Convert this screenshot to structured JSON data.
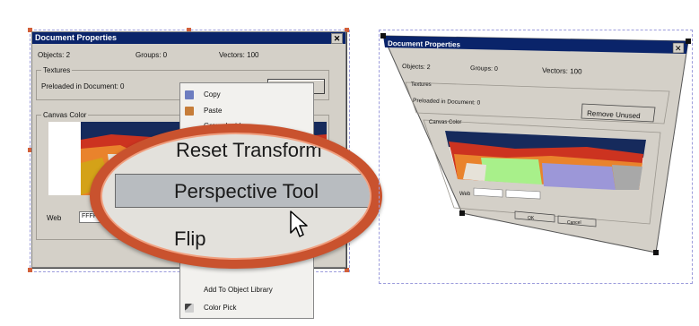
{
  "dialog": {
    "title": "Document Properties",
    "close_glyph": "✕",
    "objects_label": "Objects: 2",
    "groups_label": "Groups: 0",
    "vectors_label": "Vectors: 100",
    "textures_heading": "Textures",
    "preloaded_label": "Preloaded in Document: 0",
    "remove_unused_button": "Remove Unused",
    "canvas_color_heading": "Canvas Color",
    "web_label": "Web",
    "web_value": "FFFF",
    "ok_button": "OK",
    "cancel_button": "Cancel"
  },
  "context_menu": {
    "items": [
      {
        "label": "Copy",
        "icon": "copy-icon"
      },
      {
        "label": "Paste",
        "icon": "paste-icon"
      },
      {
        "label": "Group Inside",
        "icon": ""
      },
      {
        "label": "Add To Object Library",
        "icon": ""
      },
      {
        "label": "Color Pick",
        "icon": "eyedropper-icon"
      }
    ]
  },
  "magnifier": {
    "items": [
      "Reset Transform",
      "Perspective Tool",
      "Flip"
    ],
    "highlighted": "Perspective Tool",
    "cursor": "arrow-cursor-icon"
  },
  "colors": {
    "title_bar": "#0a246a",
    "dialog_face": "#d4d0c8",
    "lens_ring": "#c9522e",
    "selection_handle": "#d2603a",
    "selection_border": "#9c9cdc"
  }
}
